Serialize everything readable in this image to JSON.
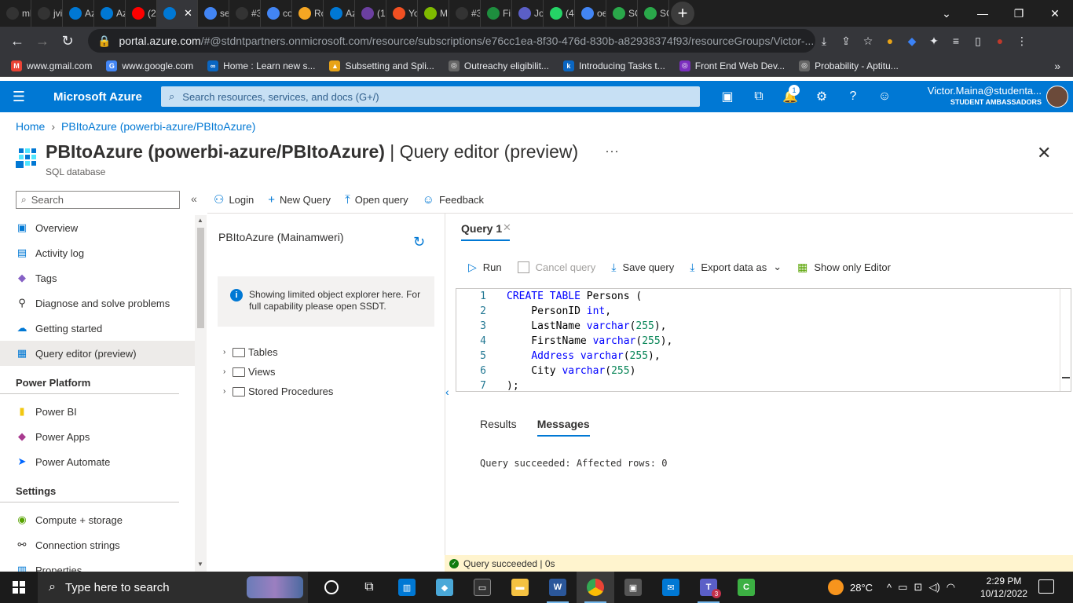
{
  "browser": {
    "tabs": [
      {
        "label": "ml",
        "color": "#333"
      },
      {
        "label": "jvi",
        "color": "#333"
      },
      {
        "label": "Az",
        "color": "#0078d4"
      },
      {
        "label": "Az",
        "color": "#0078d4"
      },
      {
        "label": "(2(",
        "color": "#ff0000"
      },
      {
        "label": "",
        "color": "#0078d4",
        "active": true
      },
      {
        "label": "se",
        "color": "#4285f4"
      },
      {
        "label": "#3",
        "color": "#333"
      },
      {
        "label": "co",
        "color": "#4285f4"
      },
      {
        "label": "Rc",
        "color": "#f5a623"
      },
      {
        "label": "Az",
        "color": "#0078d4"
      },
      {
        "label": "(1,",
        "color": "#6b3fa0"
      },
      {
        "label": "Yo",
        "color": "#f25022"
      },
      {
        "label": "M",
        "color": "#7fba00"
      },
      {
        "label": "#3",
        "color": "#333"
      },
      {
        "label": "Fi",
        "color": "#1e8e3e"
      },
      {
        "label": "Jo",
        "color": "#5b5fc7"
      },
      {
        "label": "(4",
        "color": "#25d366"
      },
      {
        "label": "oe",
        "color": "#4285f4"
      },
      {
        "label": "SC",
        "color": "#2aa84a"
      },
      {
        "label": "SC",
        "color": "#2aa84a"
      }
    ],
    "url_host": "portal.azure.com",
    "url_rest": "/#@stdntpartners.onmicrosoft.com/resource/subscriptions/e76cc1ea-8f30-476d-830b-a82938374f93/resourceGroups/Victor-...",
    "bookmarks": [
      {
        "label": "www.gmail.com",
        "color": "#ea4335",
        "glyph": "M"
      },
      {
        "label": "www.google.com",
        "color": "#4285f4",
        "glyph": "G"
      },
      {
        "label": "Home : Learn new s...",
        "color": "#0a66c2",
        "glyph": "∞"
      },
      {
        "label": "Subsetting and Spli...",
        "color": "#e8a317",
        "glyph": "▲"
      },
      {
        "label": "Outreachy eligibilit...",
        "color": "#666",
        "glyph": "◎"
      },
      {
        "label": "Introducing Tasks t...",
        "color": "#0a66c2",
        "glyph": "k"
      },
      {
        "label": "Front End Web Dev...",
        "color": "#7b2fbe",
        "glyph": "◎"
      },
      {
        "label": "Probability - Aptitu...",
        "color": "#666",
        "glyph": "◎"
      }
    ]
  },
  "azure": {
    "brand": "Microsoft Azure",
    "search_placeholder": "Search resources, services, and docs (G+/)",
    "notification_count": "1",
    "account_name": "Victor.Maina@studenta...",
    "account_role": "STUDENT AMBASSADORS"
  },
  "breadcrumb": {
    "home": "Home",
    "resource": "PBItoAzure (powerbi-azure/PBItoAzure)"
  },
  "page": {
    "title_bold": "PBItoAzure (powerbi-azure/PBItoAzure)",
    "title_rest": " | Query editor (preview)",
    "ellipsis": "···",
    "subtitle": "SQL database"
  },
  "leftnav": {
    "search_placeholder": "Search",
    "items_top": [
      {
        "label": "Overview",
        "icon": "sql-icon"
      },
      {
        "label": "Activity log",
        "icon": "activity-log-icon"
      },
      {
        "label": "Tags",
        "icon": "tag-icon"
      },
      {
        "label": "Diagnose and solve problems",
        "icon": "wrench-icon"
      },
      {
        "label": "Getting started",
        "icon": "cloud-icon"
      },
      {
        "label": "Query editor (preview)",
        "icon": "query-editor-icon",
        "selected": true
      }
    ],
    "section_power": "Power Platform",
    "items_power": [
      {
        "label": "Power BI",
        "icon": "power-bi-icon"
      },
      {
        "label": "Power Apps",
        "icon": "power-apps-icon"
      },
      {
        "label": "Power Automate",
        "icon": "power-automate-icon"
      }
    ],
    "section_settings": "Settings",
    "items_settings": [
      {
        "label": "Compute + storage",
        "icon": "compute-icon"
      },
      {
        "label": "Connection strings",
        "icon": "link-icon"
      },
      {
        "label": "Properties",
        "icon": "properties-icon"
      }
    ]
  },
  "commands": {
    "login": "Login",
    "new_query": "New Query",
    "open_query": "Open query",
    "feedback": "Feedback"
  },
  "explorer": {
    "database": "PBItoAzure (Mainamweri)",
    "info": "Showing limited object explorer here. For full capability please open SSDT.",
    "tables": "Tables",
    "views": "Views",
    "stored_procedures": "Stored Procedures"
  },
  "editor": {
    "tab_label": "Query 1",
    "run": "Run",
    "cancel_query": "Cancel query",
    "save_query": "Save query",
    "export_data": "Export data as",
    "show_only_editor": "Show only Editor",
    "lines": [
      {
        "n": "1",
        "parts": [
          [
            "kw",
            "CREATE TABLE"
          ],
          [
            "t",
            " Persons ("
          ]
        ]
      },
      {
        "n": "2",
        "parts": [
          [
            "t",
            "    PersonID "
          ],
          [
            "kw",
            "int"
          ],
          [
            "t",
            ","
          ]
        ]
      },
      {
        "n": "3",
        "parts": [
          [
            "t",
            "    LastName "
          ],
          [
            "kw",
            "varchar"
          ],
          [
            "t",
            "("
          ],
          [
            "num",
            "255"
          ],
          [
            "t",
            "),"
          ]
        ]
      },
      {
        "n": "4",
        "parts": [
          [
            "t",
            "    FirstName "
          ],
          [
            "kw",
            "varchar"
          ],
          [
            "t",
            "("
          ],
          [
            "num",
            "255"
          ],
          [
            "t",
            "),"
          ]
        ]
      },
      {
        "n": "5",
        "parts": [
          [
            "t",
            "    "
          ],
          [
            "kw",
            "Address varchar"
          ],
          [
            "t",
            "("
          ],
          [
            "num",
            "255"
          ],
          [
            "t",
            "),"
          ]
        ]
      },
      {
        "n": "6",
        "parts": [
          [
            "t",
            "    City "
          ],
          [
            "kw",
            "varchar"
          ],
          [
            "t",
            "("
          ],
          [
            "num",
            "255"
          ],
          [
            "t",
            ")"
          ]
        ]
      },
      {
        "n": "7",
        "parts": [
          [
            "t",
            ");"
          ]
        ]
      }
    ]
  },
  "results": {
    "tab_results": "Results",
    "tab_messages": "Messages",
    "message": "Query succeeded: Affected rows: 0"
  },
  "status": {
    "text": "Query succeeded | 0s"
  },
  "taskbar": {
    "search_placeholder": "Type here to search",
    "temperature": "28°C",
    "time": "2:29 PM",
    "date": "10/12/2022",
    "teams_badge": "3"
  }
}
